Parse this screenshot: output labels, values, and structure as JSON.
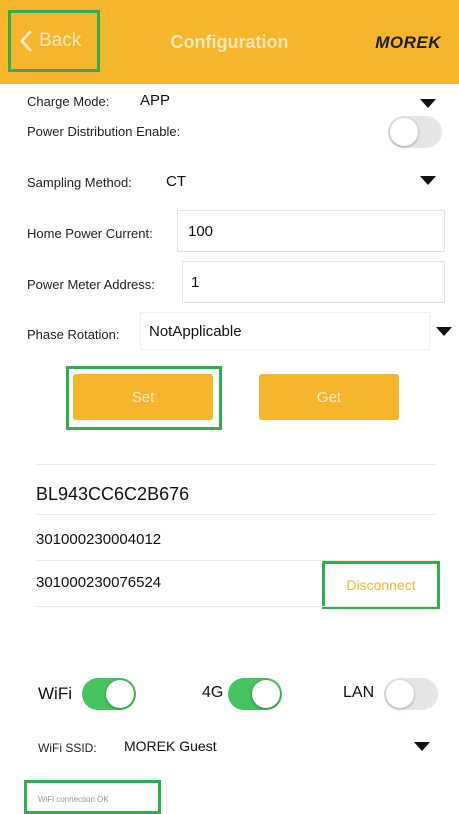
{
  "header": {
    "back_label": "Back",
    "title": "Configuration",
    "logo": "MOREK"
  },
  "config": {
    "charge_mode_label": "Charge Mode:",
    "charge_mode_value": "APP",
    "power_distribution_label": "Power Distribution Enable:",
    "power_distribution_enabled": false,
    "sampling_method_label": "Sampling Method:",
    "sampling_method_value": "CT",
    "home_power_current_label": "Home Power Current:",
    "home_power_current_value": "100",
    "power_meter_address_label": "Power Meter Address:",
    "power_meter_address_value": "1",
    "phase_rotation_label": "Phase Rotation:",
    "phase_rotation_value": "NotApplicable"
  },
  "actions": {
    "set_label": "Set",
    "get_label": "Get"
  },
  "device": {
    "id": "BL943CC6C2B676",
    "serial_1": "301000230004012",
    "serial_2": "301000230076524",
    "disconnect_label": "Disconnect"
  },
  "network": {
    "wifi_label": "WiFi",
    "wifi_enabled": true,
    "g4_label": "4G",
    "g4_enabled": true,
    "lan_label": "LAN",
    "lan_enabled": false,
    "ssid_label": "WiFi SSID:",
    "ssid_value": "MOREK Guest",
    "status_text": "WiFi connection OK"
  },
  "colors": {
    "accent": "#f5b52c",
    "toggle_on": "#46c25f",
    "highlight": "#2fb04d"
  },
  "icons": {
    "back": "chevron-left-icon",
    "dropdown": "caret-down-icon"
  }
}
